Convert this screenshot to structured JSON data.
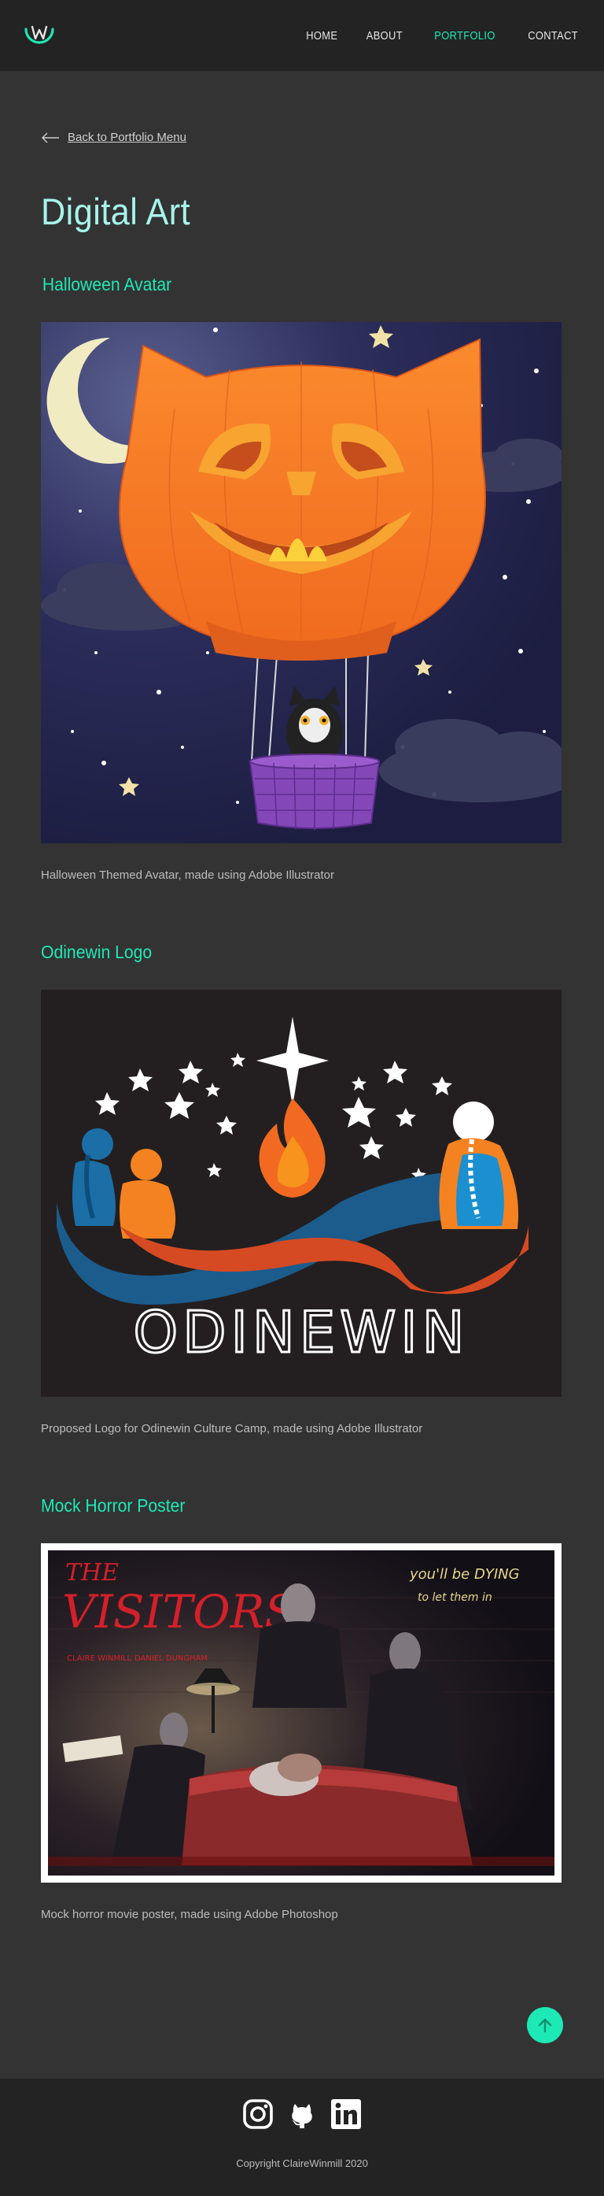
{
  "header": {
    "logo_icon": "w-logo-icon",
    "nav": [
      {
        "label": "HOME",
        "active": false
      },
      {
        "label": "ABOUT",
        "active": false
      },
      {
        "label": "PORTFOLIO",
        "active": true
      },
      {
        "label": "CONTACT",
        "active": false
      }
    ]
  },
  "back_link": {
    "label": "Back to Portfolio Menu",
    "icon": "arrow-left-icon"
  },
  "page_title": "Digital Art",
  "projects": [
    {
      "title": "Halloween Avatar",
      "caption": "Halloween Themed Avatar,  made using Adobe Illustrator"
    },
    {
      "title": "Odinewin Logo",
      "logo_text": "ODINEWIN",
      "caption": "Proposed Logo for Odinewin Culture Camp, made using Adobe Illustrator"
    },
    {
      "title": "Mock Horror Poster",
      "poster": {
        "title_top": "THE",
        "title_main": "VISITORS",
        "tagline_1": "you'll be DYING",
        "tagline_2": "to let them in",
        "actor_1": "CLAIRE WINMILL",
        "actor_2": "DANIEL DUNGHAM"
      },
      "caption": "Mock horror movie poster,  made using Adobe Photoshop"
    }
  ],
  "back_to_top_icon": "arrow-up-icon",
  "footer": {
    "social_icons": [
      "instagram-icon",
      "github-icon",
      "linkedin-icon"
    ],
    "copyright": "Copyright ClaireWinmill 2020"
  },
  "colors": {
    "accent": "#1de9b6",
    "title": "#a7f4ea",
    "background": "#333333",
    "header": "#232323"
  }
}
